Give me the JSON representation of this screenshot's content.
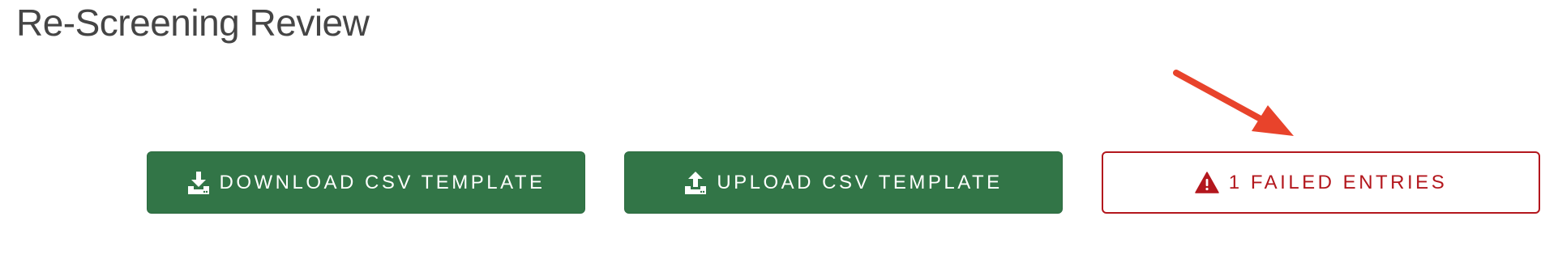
{
  "page": {
    "title": "Re-Screening Review"
  },
  "actions": {
    "download_label": "DOWNLOAD CSV TEMPLATE",
    "upload_label": "UPLOAD CSV TEMPLATE",
    "failed_label": "1 FAILED ENTRIES",
    "download_icon": "download-icon",
    "upload_icon": "upload-icon",
    "failed_icon": "warning-icon"
  },
  "colors": {
    "primary_green": "#327547",
    "danger_red": "#b3171d",
    "title_gray": "#454545",
    "annotation_arrow": "#e8432b"
  }
}
